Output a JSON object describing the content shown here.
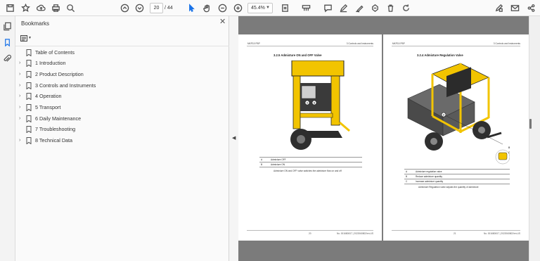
{
  "toolbar": {
    "page_current": "20",
    "page_total_sep": "/ 44",
    "zoom": "45.4%",
    "icons": [
      "save-icon",
      "bookmark-star-icon",
      "upload-icon",
      "print-icon",
      "zoom-search-icon",
      "page-up-icon",
      "page-down-icon",
      "select-cursor-icon",
      "hand-icon",
      "zoom-out-icon",
      "zoom-in-icon",
      "fit-page-icon",
      "read-mode-icon",
      "comment-icon",
      "highlight-pen-icon",
      "sign-pen-icon",
      "stamp-icon",
      "delete-icon",
      "rotate-icon",
      "edit-tools-icon",
      "mail-icon",
      "share-icon"
    ]
  },
  "bookmarks": {
    "title": "Bookmarks",
    "close": "✕",
    "items": [
      {
        "label": "Table of Contents",
        "expandable": false
      },
      {
        "label": "1 Introduction",
        "expandable": true
      },
      {
        "label": "2 Product Description",
        "expandable": true
      },
      {
        "label": "3 Controls and Instruments",
        "expandable": true
      },
      {
        "label": "4 Operation",
        "expandable": true
      },
      {
        "label": "5 Transport",
        "expandable": true
      },
      {
        "label": "6 Daily Maintenance",
        "expandable": true
      },
      {
        "label": "7 Troubleshooting",
        "expandable": false
      },
      {
        "label": "8 Technical Data",
        "expandable": true
      }
    ]
  },
  "left_page": {
    "header_left": "MKP15 PBP",
    "header_right": "3 Controls and Instruments",
    "section_title": "3.2.5 Admixture ON and OFF Valve",
    "table": [
      {
        "key": "A",
        "value": "Admixture OFF"
      },
      {
        "key": "B",
        "value": "Admixture ON"
      }
    ],
    "caption": "Admixture ON and OFF valve switches the admixture flow on and off",
    "footer_page": "20",
    "footer_doc": "No. 001680007 | 2022060802/en-US"
  },
  "right_page": {
    "header_left": "MKP15 PBP",
    "header_right": "3 Controls and Instruments",
    "section_title": "3.2.4 Admixture Regulation Valve",
    "callout_a": "A",
    "callout_b": "B",
    "callout_c": "C",
    "table": [
      {
        "key": "A",
        "value": "Admixture regulation valve"
      },
      {
        "key": "B",
        "value": "Reduce admixture quantity"
      },
      {
        "key": "C",
        "value": "Increase admixture quantity"
      }
    ],
    "caption": "Admixture Regulation valve adjusts the quantity of admixture",
    "footer_page": "21",
    "footer_doc": "No. 001680007 | 2022060802/en-US"
  },
  "left_page_callouts": {
    "a": "A",
    "b": "B"
  },
  "colors": {
    "machine_yellow": "#f2c400",
    "frame_dark": "#2b2b2b",
    "wheel": "#3a3a3a"
  }
}
